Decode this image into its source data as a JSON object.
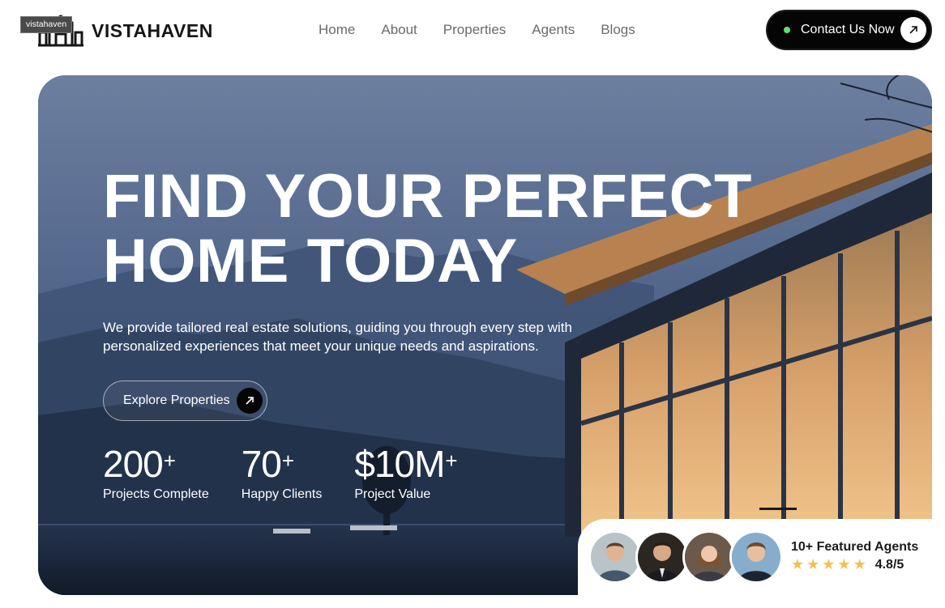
{
  "brand": {
    "name": "VISTAHAVEN",
    "tooltip": "vistahaven"
  },
  "nav": [
    "Home",
    "About",
    "Properties",
    "Agents",
    "Blogs"
  ],
  "contact_button": {
    "label": "Contact Us Now",
    "icon": "arrow-up-right-icon",
    "status_color": "#5fe36f"
  },
  "hero": {
    "title_line1": "FIND YOUR PERFECT",
    "title_line2": "HOME TODAY",
    "subtitle_line1": "We provide tailored real estate solutions, guiding you through every step with",
    "subtitle_line2": "personalized experiences that meet your unique needs and aspirations.",
    "cta": "Explore Properties"
  },
  "stats": [
    {
      "value": "200",
      "suffix": "+",
      "label": "Projects Complete"
    },
    {
      "value": "70",
      "suffix": "+",
      "label": "Happy Clients"
    },
    {
      "value": "$10M",
      "suffix": "+",
      "label": "Project Value"
    }
  ],
  "agents": {
    "title": "10+ Featured Agents",
    "stars": 5,
    "rating": "4.8/5",
    "star_color": "#f2c14e"
  }
}
